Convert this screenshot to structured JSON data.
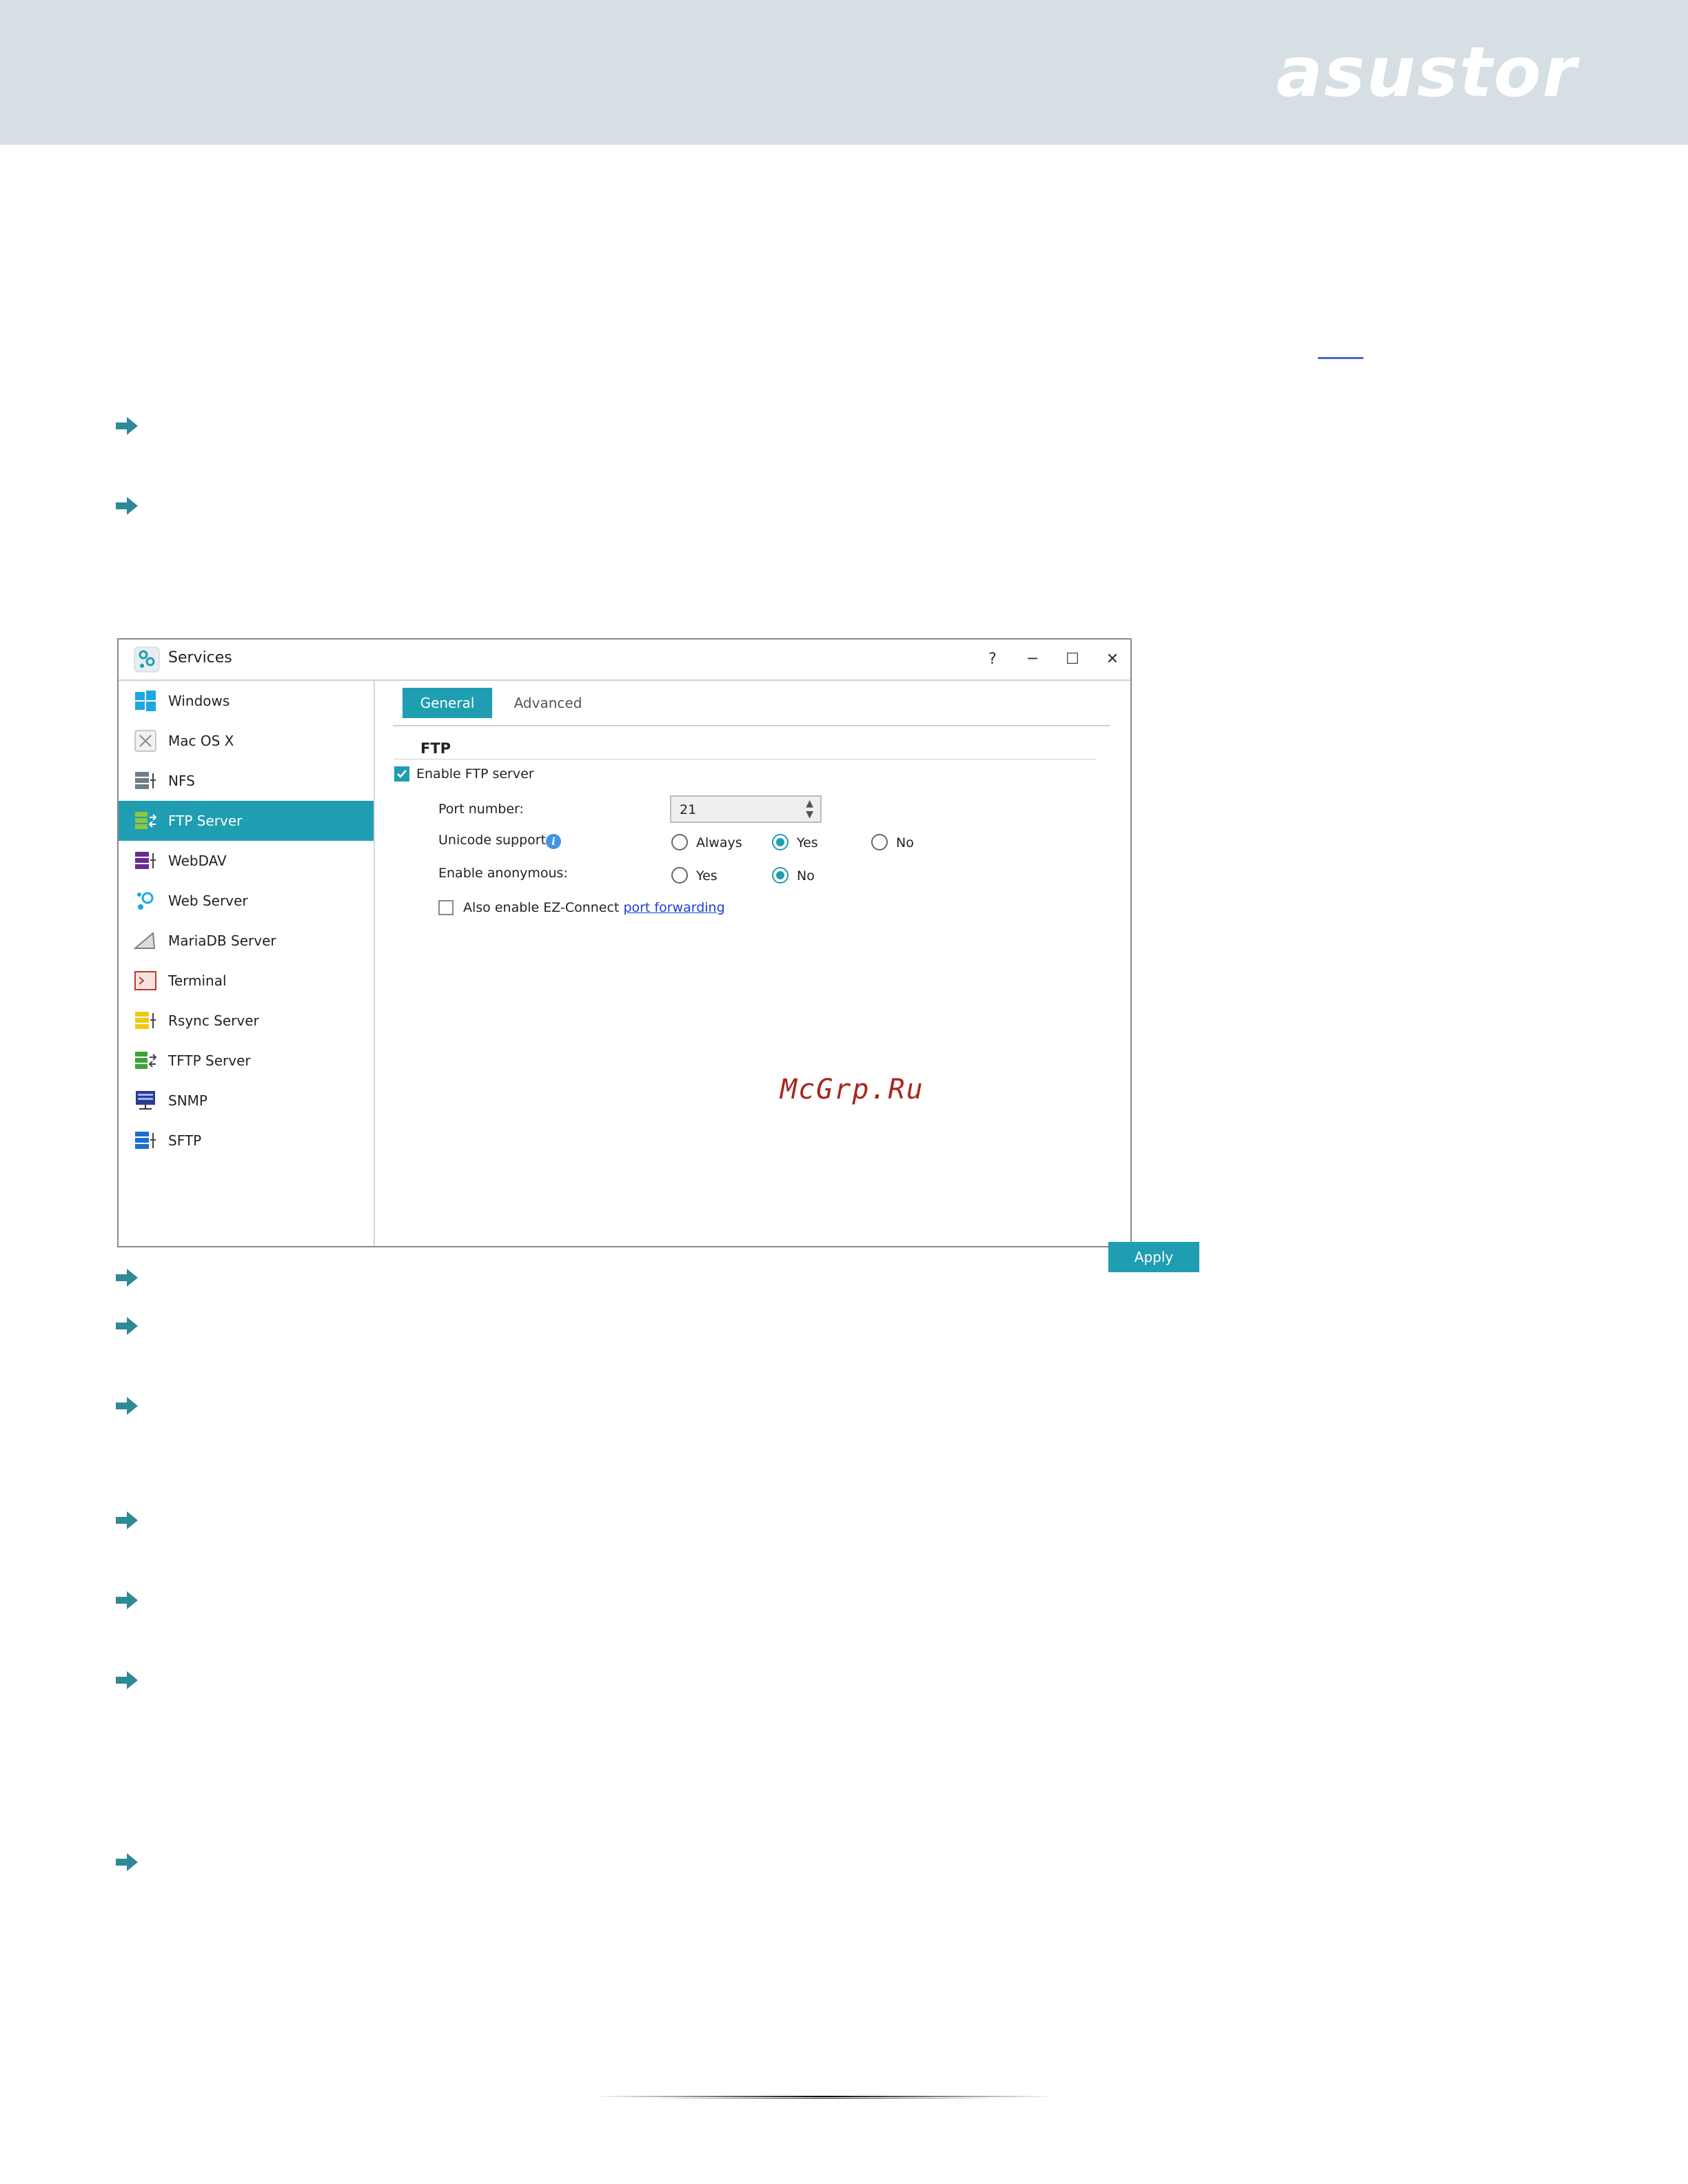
{
  "header": {
    "logo_text": "asustor",
    "band_color": "#d6dfe4"
  },
  "window": {
    "title": "Services",
    "controls": {
      "help": "?",
      "minimize": "─",
      "maximize": "☐",
      "close": "✕"
    },
    "sidebar": {
      "items": [
        {
          "label": "Windows",
          "icon": "windows-icon",
          "active": false
        },
        {
          "label": "Mac OS X",
          "icon": "mac-os-x-icon",
          "active": false
        },
        {
          "label": "NFS",
          "icon": "nfs-icon",
          "active": false
        },
        {
          "label": "FTP Server",
          "icon": "ftp-server-icon",
          "active": true
        },
        {
          "label": "WebDAV",
          "icon": "webdav-icon",
          "active": false
        },
        {
          "label": "Web Server",
          "icon": "web-server-icon",
          "active": false
        },
        {
          "label": "MariaDB Server",
          "icon": "mariadb-icon",
          "active": false
        },
        {
          "label": "Terminal",
          "icon": "terminal-icon",
          "active": false
        },
        {
          "label": "Rsync Server",
          "icon": "rsync-icon",
          "active": false
        },
        {
          "label": "TFTP Server",
          "icon": "tftp-icon",
          "active": false
        },
        {
          "label": "SNMP",
          "icon": "snmp-icon",
          "active": false
        },
        {
          "label": "SFTP",
          "icon": "sftp-icon",
          "active": false
        }
      ]
    },
    "tabs": [
      {
        "label": "General",
        "active": true
      },
      {
        "label": "Advanced",
        "active": false
      }
    ],
    "ftp": {
      "section_title": "FTP",
      "enable_label": "Enable FTP server",
      "enable_checked": true,
      "port_label": "Port number:",
      "port_value": "21",
      "unicode_label": "Unicode support",
      "unicode_options": [
        "Always",
        "Yes",
        "No"
      ],
      "unicode_selected": "Yes",
      "anon_label": "Enable anonymous:",
      "anon_options": [
        "Yes",
        "No"
      ],
      "anon_selected": "No",
      "ez_label": "Also enable EZ-Connect",
      "ez_link": "port forwarding",
      "ez_checked": false
    },
    "apply_label": "Apply",
    "accent_color": "#1f9db1"
  },
  "watermark": "McGrp.Ru"
}
